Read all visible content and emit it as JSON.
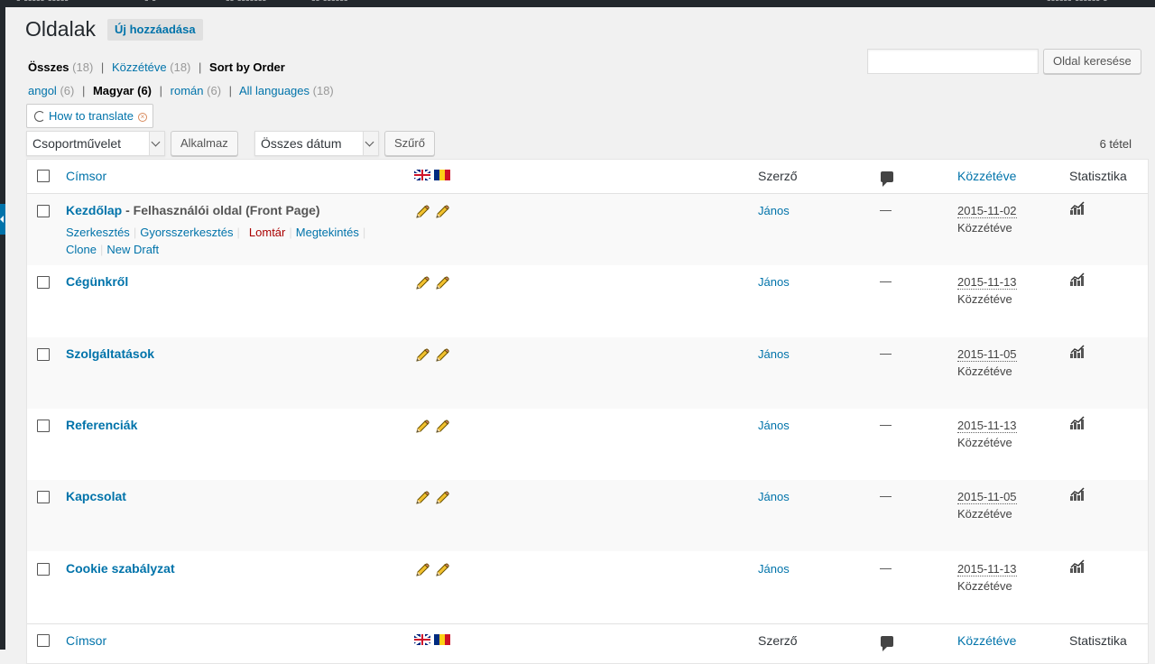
{
  "page": {
    "title": "Oldalak",
    "add_new": "Új hozzáadása"
  },
  "search": {
    "button": "Oldal keresése",
    "value": ""
  },
  "status_links": [
    {
      "label": "Összes",
      "count": "(18)",
      "current": true
    },
    {
      "label": "Közzétéve",
      "count": "(18)",
      "current": false
    },
    {
      "label": "Sort by Order",
      "count": "",
      "current": true
    }
  ],
  "language_links": [
    {
      "label": "angol",
      "count": "(6)"
    },
    {
      "label": "Magyar",
      "count": "(6)"
    },
    {
      "label": "román",
      "count": "(6)"
    },
    {
      "label": "All languages",
      "count": "(18)"
    }
  ],
  "how_to_translate": "How to translate",
  "bulk": {
    "select": "Csoportművelet",
    "apply": "Alkalmaz"
  },
  "date_filter": {
    "select": "Összes dátum",
    "filter": "Szűrő"
  },
  "items_count": "6 tétel",
  "columns": {
    "title": "Címsor",
    "author": "Szerző",
    "date": "Közzétéve",
    "stats": "Statisztika"
  },
  "row_actions": {
    "edit": "Szerkesztés",
    "quick_edit": "Gyorsszerkesztés",
    "trash": "Lomtár",
    "view": "Megtekintés",
    "clone": "Clone",
    "new_draft": "New Draft"
  },
  "rows": [
    {
      "title": "Kezdőlap",
      "state": " - Felhasználói oldal (Front Page)",
      "author": "János",
      "comments": "—",
      "date": "2015-11-02",
      "status": "Közzétéve"
    },
    {
      "title": "Cégünkről",
      "state": "",
      "author": "János",
      "comments": "—",
      "date": "2015-11-13",
      "status": "Közzétéve"
    },
    {
      "title": "Szolgáltatások",
      "state": "",
      "author": "János",
      "comments": "—",
      "date": "2015-11-05",
      "status": "Közzétéve"
    },
    {
      "title": "Referenciák",
      "state": "",
      "author": "János",
      "comments": "—",
      "date": "2015-11-13",
      "status": "Közzétéve"
    },
    {
      "title": "Kapcsolat",
      "state": "",
      "author": "János",
      "comments": "—",
      "date": "2015-11-05",
      "status": "Közzétéve"
    },
    {
      "title": "Cookie szabályzat",
      "state": "",
      "author": "János",
      "comments": "—",
      "date": "2015-11-13",
      "status": "Közzétéve"
    }
  ],
  "icons": {
    "flags": [
      "uk-flag-icon",
      "romania-flag-icon"
    ],
    "edit": "pencil-icon",
    "comments": "comment-bubble-icon",
    "stats": "stats-chart-icon",
    "help": "question-icon",
    "close": "close-circle-icon"
  },
  "colors": {
    "link": "#0073aa",
    "admin_bar": "#23282d",
    "trash": "#aa0000",
    "background": "#f1f1f1"
  }
}
